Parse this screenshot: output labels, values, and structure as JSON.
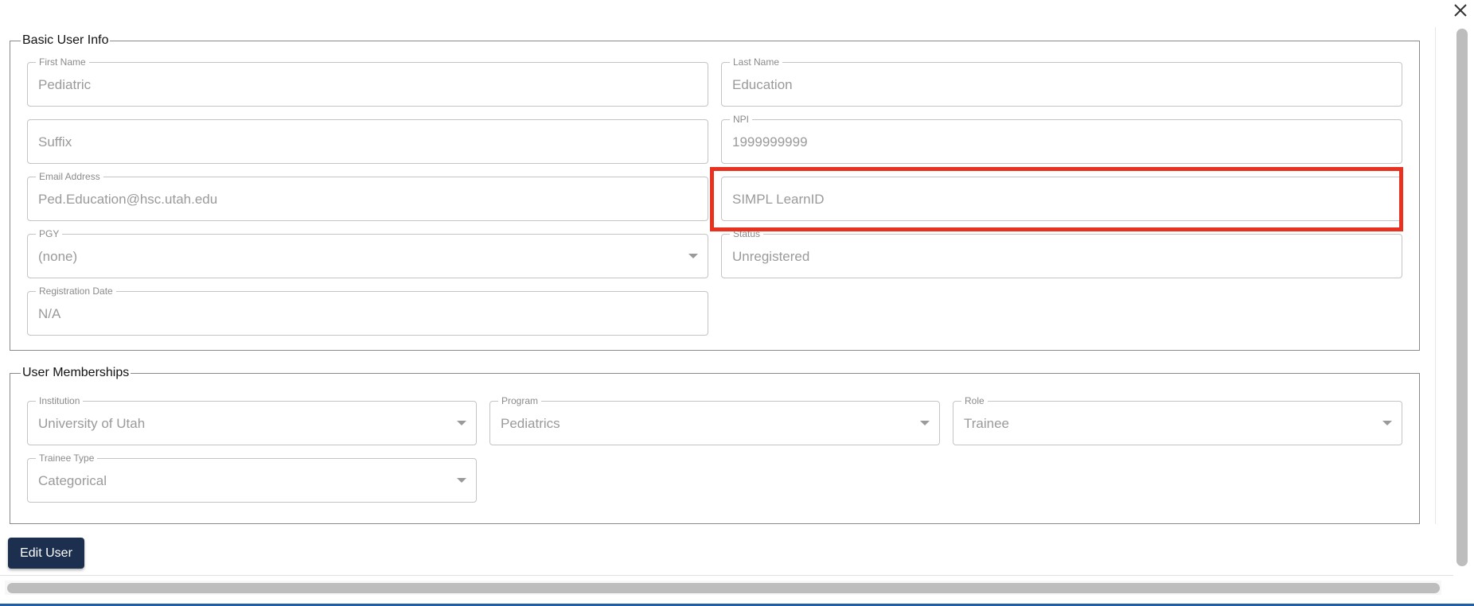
{
  "dialog": {
    "close_icon": "close-icon"
  },
  "basic_info": {
    "legend": "Basic User Info",
    "first_name": {
      "label": "First Name",
      "value": "Pediatric"
    },
    "last_name": {
      "label": "Last Name",
      "value": "Education"
    },
    "suffix": {
      "label": "",
      "value": "Suffix"
    },
    "npi": {
      "label": "NPI",
      "value": "1999999999"
    },
    "email": {
      "label": "Email Address",
      "value": "Ped.Education@hsc.utah.edu"
    },
    "learn_id": {
      "label": "",
      "value": "SIMPL LearnID"
    },
    "pgy": {
      "label": "PGY",
      "value": "(none)"
    },
    "status": {
      "label": "Status",
      "value": "Unregistered"
    },
    "registration_date": {
      "label": "Registration Date",
      "value": "N/A"
    }
  },
  "memberships": {
    "legend": "User Memberships",
    "institution": {
      "label": "Institution",
      "value": "University of Utah"
    },
    "program": {
      "label": "Program",
      "value": "Pediatrics"
    },
    "role": {
      "label": "Role",
      "value": "Trainee"
    },
    "trainee_type": {
      "label": "Trainee Type",
      "value": "Categorical"
    }
  },
  "actions": {
    "edit_label": "Edit User"
  },
  "colors": {
    "highlight": "#e8311f",
    "button_bg": "#1c2f4e",
    "accent_line": "#1f5fa8"
  }
}
